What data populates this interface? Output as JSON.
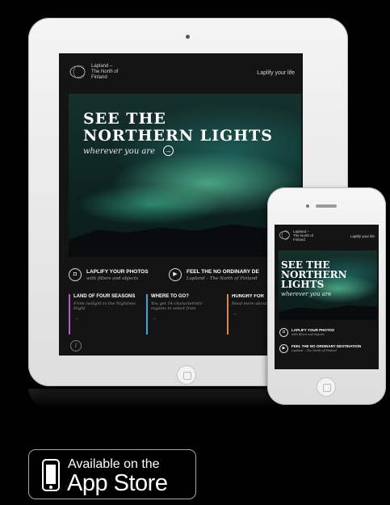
{
  "ipad": {
    "logo_text": "Lapland –\nThe North of\nFinland",
    "tagline": "Laplify your life",
    "hero": {
      "line1": "SEE THE",
      "line2": "NORTHERN LIGHTS",
      "subtitle": "wherever you are",
      "arrow": "→"
    },
    "promos": [
      {
        "title": "LAPLIFY YOUR PHOTOS",
        "subtitle": "with filters and objects",
        "icon": "camera-icon"
      },
      {
        "title": "FEEL THE NO ORDINARY DE",
        "subtitle": "Lapland – The North of Finland",
        "icon": "play-icon"
      }
    ],
    "columns": [
      {
        "title": "LAND OF FOUR SEASONS",
        "text": "From twilight to the Nightless Night",
        "arrow": "→",
        "color": "#b35dc8"
      },
      {
        "title": "WHERE TO GO?",
        "text": "You get 14 characteristic regions to select from",
        "arrow": "→",
        "color": "#3aa7d8"
      },
      {
        "title": "HUNGRY FOR",
        "text": "Read more about ordinary dest",
        "arrow": "→",
        "color": "#e08a2a"
      }
    ],
    "info_symbol": "i"
  },
  "iphone": {
    "logo_text": "Lapland –\nThe North of\nFinland",
    "tagline": "Laplify your life",
    "hero": {
      "line1": "SEE THE",
      "line2": "NORTHERN",
      "line3": "LIGHTS",
      "subtitle": "wherever you are"
    },
    "rows": [
      {
        "title": "LAPLIFY YOUR PHOTOS",
        "subtitle": "with filters and objects"
      },
      {
        "title": "FEEL THE NO ORDINARY DESTINATION",
        "subtitle": "Lapland – The North of Finland"
      }
    ]
  },
  "badge": {
    "small": "Available on the",
    "big": "App Store"
  }
}
